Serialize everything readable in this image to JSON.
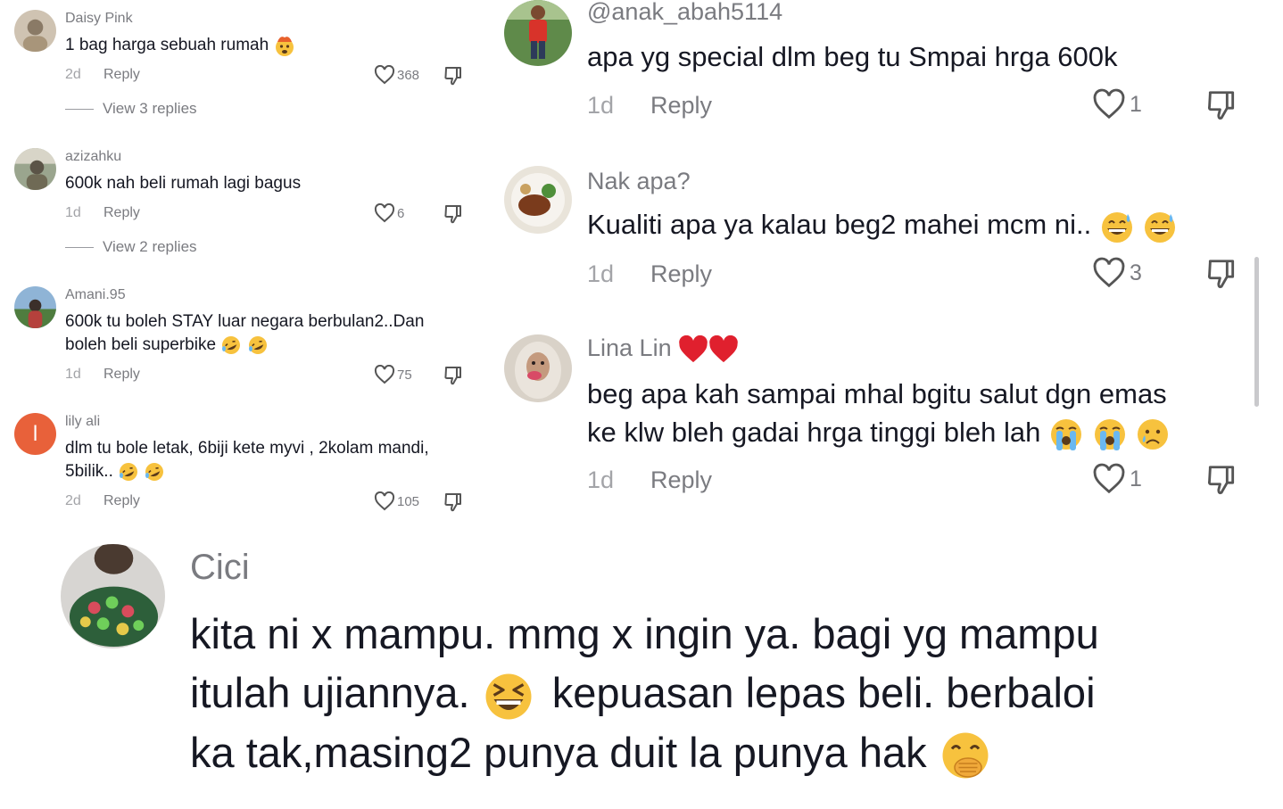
{
  "left_comments": [
    {
      "username": "Daisy Pink",
      "text": "1 bag harga sebuah rumah",
      "emoji_icons": [
        "exploding-head-emoji"
      ],
      "time": "2d",
      "reply_label": "Reply",
      "likes": "368",
      "view_replies": "View 3 replies"
    },
    {
      "username": "azizahku",
      "text": "600k nah beli rumah lagi bagus",
      "time": "1d",
      "reply_label": "Reply",
      "likes": "6",
      "view_replies": "View 2 replies"
    },
    {
      "username": "Amani.95",
      "text_line1": "600k tu boleh STAY luar negara berbulan2..Dan",
      "text_line2": "boleh beli superbike",
      "emoji_icons": [
        "rofl-emoji",
        "rofl-emoji"
      ],
      "time": "1d",
      "reply_label": "Reply",
      "likes": "75"
    },
    {
      "username": "lily ali",
      "avatar_letter": "l",
      "avatar_color": "#e8613a",
      "text_line1": "dlm tu bole letak, 6biji kete myvi , 2kolam mandi,",
      "text_line2": "5bilik..",
      "emoji_icons": [
        "rofl-emoji",
        "rofl-emoji"
      ],
      "time": "2d",
      "reply_label": "Reply",
      "likes": "105"
    }
  ],
  "right_comments": [
    {
      "username": "@anak_abah5114",
      "text": "apa yg special dlm beg tu Smpai hrga 600k",
      "time": "1d",
      "reply_label": "Reply",
      "likes": "1"
    },
    {
      "username": "Nak apa?",
      "text": "Kualiti apa ya kalau beg2 mahei mcm ni..",
      "emoji_icons": [
        "grinning-sweat-emoji",
        "grinning-sweat-emoji"
      ],
      "time": "1d",
      "reply_label": "Reply",
      "likes": "3"
    },
    {
      "username": "Lina Lin",
      "username_emoji_icons": [
        "red-heart-emoji",
        "red-heart-emoji"
      ],
      "text_line1": "beg apa kah sampai mhal bgitu salut dgn emas",
      "text_line2": "ke klw bleh gadai hrga tinggi bleh lah",
      "emoji_icons": [
        "loudly-crying-emoji",
        "loudly-crying-emoji",
        "crying-emoji"
      ],
      "time": "1d",
      "reply_label": "Reply",
      "likes": "1"
    }
  ],
  "bottom_comment": {
    "username": "Cici",
    "text_line1": "kita ni x mampu. mmg x ingin ya. bagi yg mampu",
    "text_line2a": "itulah ujiannya.",
    "text_line2b": "kepuasan lepas beli. berbaloi",
    "text_line3": "ka tak,masing2 punya duit la punya hak",
    "emoji_icons": [
      "laughing-squint-emoji",
      "hand-over-mouth-emoji"
    ]
  },
  "colors": {
    "text_primary": "#161823",
    "text_secondary": "#7a7b80",
    "text_tertiary": "#a3a4a8",
    "emoji_yellow": "#f7c23e"
  }
}
